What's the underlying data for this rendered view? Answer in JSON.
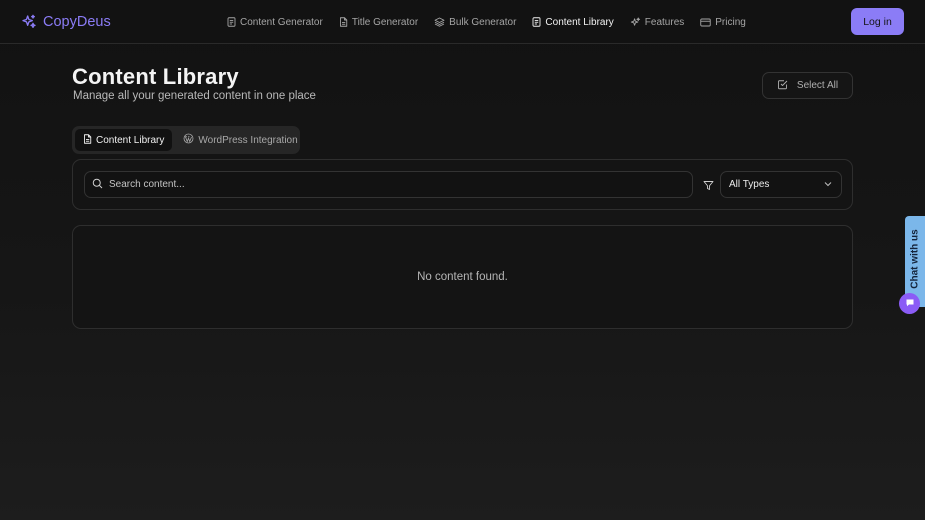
{
  "brand": {
    "name": "CopyDeus",
    "icon": "sparkles-icon",
    "color": "#8b7cf6"
  },
  "nav": {
    "items": [
      {
        "label": "Content Generator",
        "icon": "document-icon",
        "active": false
      },
      {
        "label": "Title Generator",
        "icon": "file-icon",
        "active": false
      },
      {
        "label": "Bulk Generator",
        "icon": "layers-icon",
        "active": false
      },
      {
        "label": "Content Library",
        "icon": "document-icon",
        "active": true
      },
      {
        "label": "Features",
        "icon": "sparkles-icon",
        "active": false
      },
      {
        "label": "Pricing",
        "icon": "credit-card-icon",
        "active": false
      }
    ],
    "login_label": "Log in"
  },
  "page": {
    "title": "Content Library",
    "subtitle": "Manage all your generated content in one place",
    "select_all_label": "Select All"
  },
  "tabs": [
    {
      "label": "Content Library",
      "icon": "document-icon",
      "active": true
    },
    {
      "label": "WordPress Integration",
      "icon": "wordpress-icon",
      "active": false
    }
  ],
  "filters": {
    "search_placeholder": "Search content...",
    "type_selected": "All Types"
  },
  "empty_state": {
    "message": "No content found."
  },
  "chat_widget": {
    "label": "Chat with us",
    "color": "#7bb7ea",
    "bubble_color": "#8b5cf6"
  }
}
